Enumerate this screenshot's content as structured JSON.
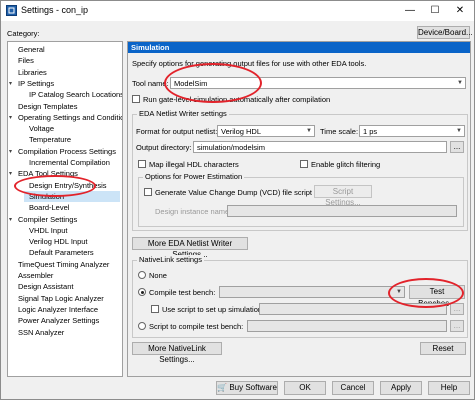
{
  "window": {
    "title": "Settings - con_ip",
    "min_glyph": "—",
    "max_glyph": "☐",
    "close_glyph": "✕"
  },
  "category_label": "Category:",
  "device_board_button": "Device/Board...",
  "tree": [
    {
      "label": "General",
      "indent": 0
    },
    {
      "label": "Files",
      "indent": 0
    },
    {
      "label": "Libraries",
      "indent": 0
    },
    {
      "label": "IP Settings",
      "indent": 0,
      "expand": "v"
    },
    {
      "label": "IP Catalog Search Locations",
      "indent": 1
    },
    {
      "label": "Design Templates",
      "indent": 0
    },
    {
      "label": "Operating Settings and Conditic",
      "indent": 0,
      "expand": "v"
    },
    {
      "label": "Voltage",
      "indent": 1
    },
    {
      "label": "Temperature",
      "indent": 1
    },
    {
      "label": "Compilation Process Settings",
      "indent": 0,
      "expand": "v"
    },
    {
      "label": "Incremental Compilation",
      "indent": 1
    },
    {
      "label": "EDA Tool Settings",
      "indent": 0,
      "expand": "v"
    },
    {
      "label": "Design Entry/Synthesis",
      "indent": 1
    },
    {
      "label": "Simulation",
      "indent": 1,
      "selected": true
    },
    {
      "label": "Board-Level",
      "indent": 1
    },
    {
      "label": "Compiler Settings",
      "indent": 0,
      "expand": "v"
    },
    {
      "label": "VHDL Input",
      "indent": 1
    },
    {
      "label": "Verilog HDL Input",
      "indent": 1
    },
    {
      "label": "Default Parameters",
      "indent": 1
    },
    {
      "label": "TimeQuest Timing Analyzer",
      "indent": 0
    },
    {
      "label": "Assembler",
      "indent": 0
    },
    {
      "label": "Design Assistant",
      "indent": 0
    },
    {
      "label": "Signal Tap Logic Analyzer",
      "indent": 0
    },
    {
      "label": "Logic Analyzer Interface",
      "indent": 0
    },
    {
      "label": "Power Analyzer Settings",
      "indent": 0
    },
    {
      "label": "SSN Analyzer",
      "indent": 0
    }
  ],
  "panel": {
    "title": "Simulation",
    "description": "Specify options for generating output files for use with other EDA tools.",
    "tool_name_label": "Tool name:",
    "tool_name_value": "ModelSim",
    "run_gate_level": "Run gate-level simulation automatically after compilation",
    "eda_group_title": "EDA Netlist Writer settings",
    "format_label": "Format for output netlist:",
    "format_value": "Verilog HDL",
    "timescale_label": "Time scale:",
    "timescale_value": "1 ps",
    "output_dir_label": "Output directory:",
    "output_dir_value": "simulation/modelsim",
    "browse": "...",
    "map_illegal": "Map illegal HDL characters",
    "enable_glitch": "Enable glitch filtering",
    "power_group_title": "Options for Power Estimation",
    "gen_vcd": "Generate Value Change Dump (VCD) file script",
    "script_settings": "Script Settings...",
    "design_instance_label": "Design instance name:",
    "more_eda_button": "More EDA Netlist Writer Settings...",
    "nativelink_title": "NativeLink settings",
    "none_label": "None",
    "compile_tb_label": "Compile test bench:",
    "test_benches_button": "Test Benches...",
    "use_script_label": "Use script to set up simulation:",
    "script_compile_label": "Script to compile test bench:",
    "more_nativelink_button": "More NativeLink Settings...",
    "reset_button": "Reset"
  },
  "footer": {
    "buy_software": "Buy Software",
    "ok": "OK",
    "cancel": "Cancel",
    "apply": "Apply",
    "help": "Help"
  },
  "colors": {
    "accent": "#0a64c8",
    "annotation": "#e2232b"
  }
}
